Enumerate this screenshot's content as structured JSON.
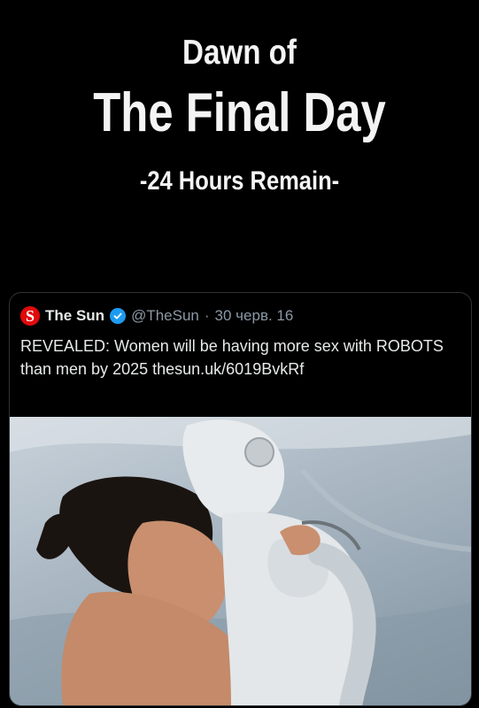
{
  "header": {
    "line1": "Dawn of",
    "line2": "The Final Day",
    "line3": "-24 Hours Remain-"
  },
  "tweet": {
    "logo_letter": "S",
    "display_name": "The Sun",
    "verified_icon": "verified-badge-icon",
    "handle": "@TheSun",
    "separator": "·",
    "date": "30 черв. 16",
    "text": "REVEALED: Women will be having more sex with ROBOTS than men by 2025 thesun.uk/6019BvkRf",
    "link_text": "thesun.uk/6019BvkRf"
  },
  "colors": {
    "background": "#000000",
    "sun_red": "#e10a0a",
    "verified_blue": "#1d9bf0",
    "secondary_text": "#8b98a5"
  }
}
